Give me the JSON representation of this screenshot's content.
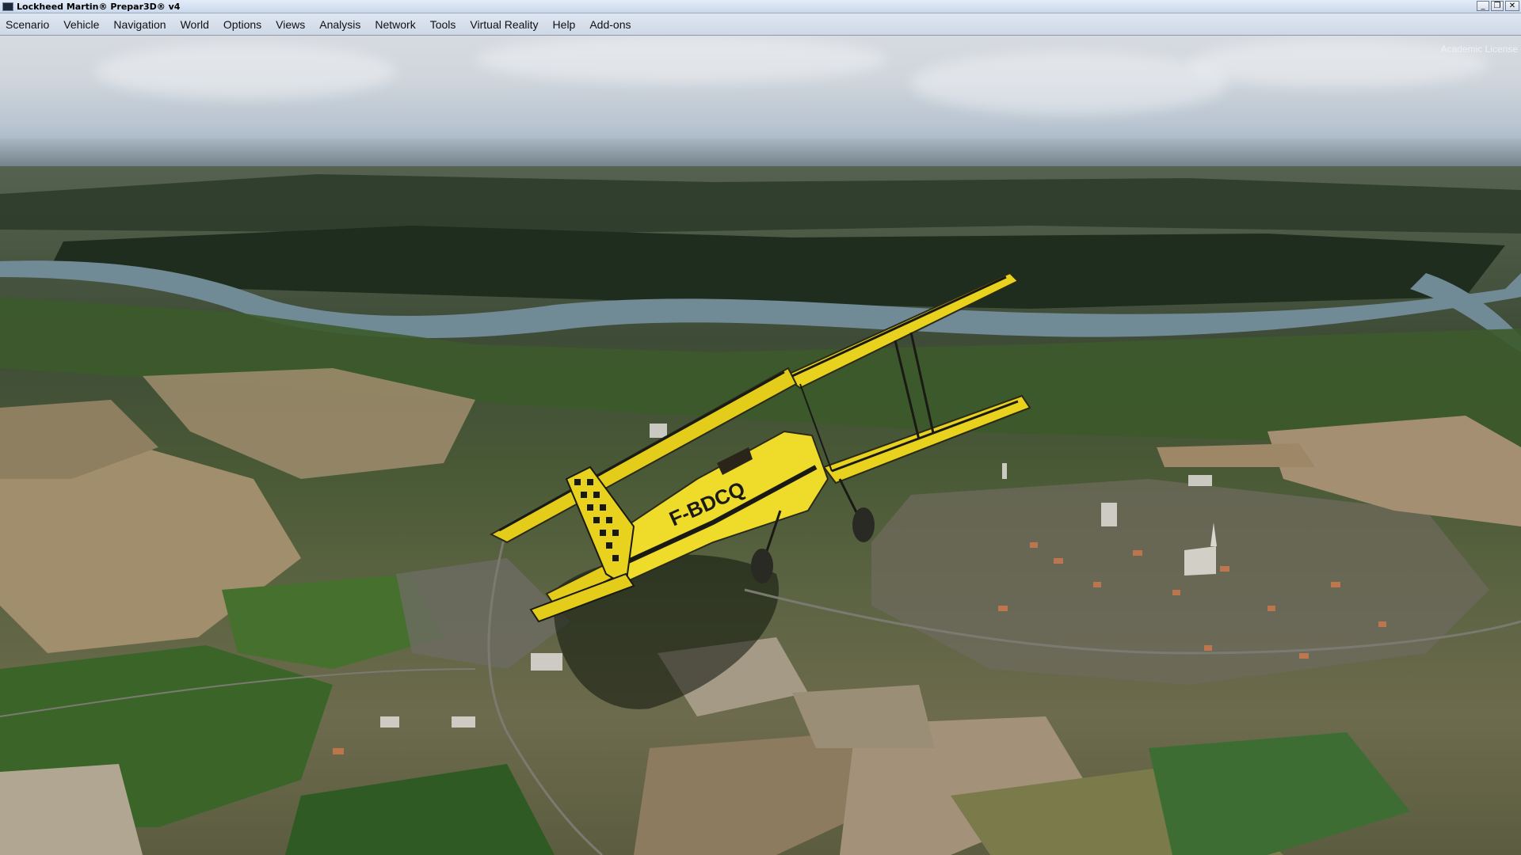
{
  "window": {
    "title": "Lockheed Martin® Prepar3D® v4",
    "controls": {
      "minimize": "_",
      "restore": "❐",
      "close": "✕"
    }
  },
  "menu": {
    "items": [
      "Scenario",
      "Vehicle",
      "Navigation",
      "World",
      "Options",
      "Views",
      "Analysis",
      "Network",
      "Tools",
      "Virtual Reality",
      "Help",
      "Add-ons"
    ]
  },
  "viewport": {
    "license_text": "Academic License",
    "aircraft_registration": "F-BDCQ"
  },
  "colors": {
    "aircraft_yellow": "#e8d21e",
    "aircraft_black": "#1a1a14",
    "river": "#6f8a95",
    "forest": "#23321f",
    "field_green": "#3f6a2a",
    "field_tan": "#a89470"
  }
}
